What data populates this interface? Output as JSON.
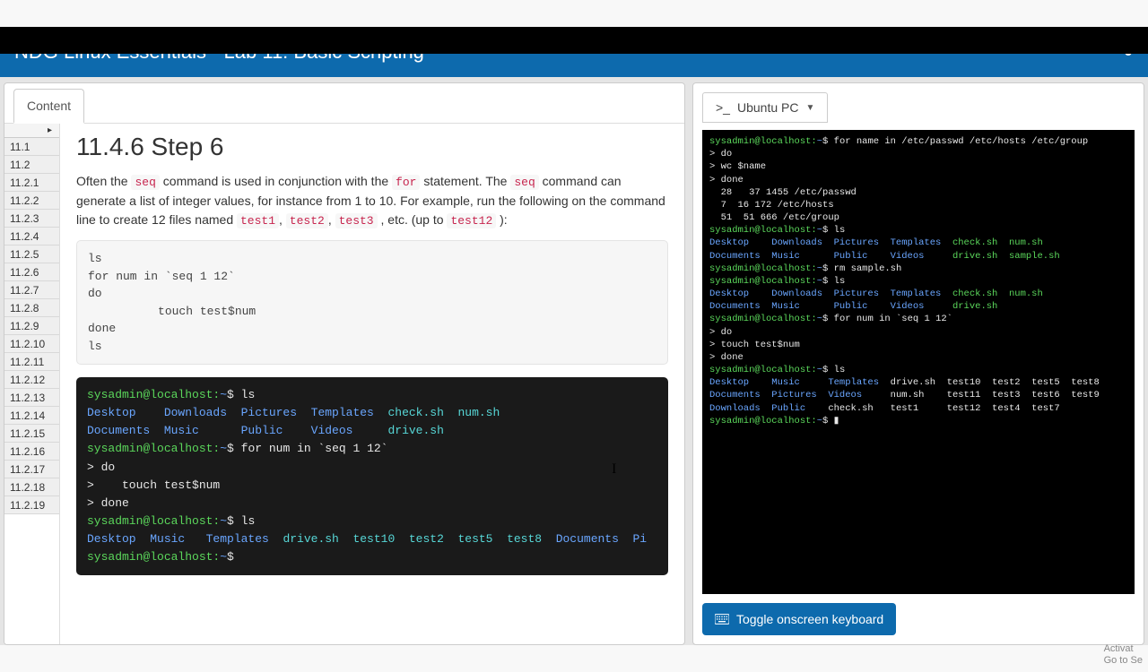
{
  "header": {
    "title": "NDG Linux Essentials - Lab 11: Basic Scripting"
  },
  "left": {
    "tab": "Content",
    "nav_expand": "▸",
    "nav": [
      "11.1",
      "11.2",
      "11.2.1",
      "11.2.2",
      "11.2.3",
      "11.2.4",
      "11.2.5",
      "11.2.6",
      "11.2.7",
      "11.2.8",
      "11.2.9",
      "11.2.10",
      "11.2.11",
      "11.2.12",
      "11.2.13",
      "11.2.14",
      "11.2.15",
      "11.2.16",
      "11.2.17",
      "11.2.18",
      "11.2.19"
    ],
    "article": {
      "heading": "11.4.6 Step 6",
      "p1a": "Often the ",
      "seq": "seq",
      "p1b": " command is used in conjunction with the ",
      "for": "for",
      "p1c": " statement. The ",
      "p1d": " command can generate a list of integer values, for instance from 1 to 10. For example, run the following on the command line to create 12 files named ",
      "t1": "test1",
      "t2": "test2",
      "t3": "test3",
      "etc": " , etc. (up to ",
      "t12": "test12",
      "close": " ):",
      "codebox": "ls\nfor num in `seq 1 12`\ndo\n          touch test$num\ndone\nls",
      "term": {
        "prompt": "sysadmin@localhost:",
        "tilde": "~",
        "dollar": "$",
        "cmd1": " ls",
        "row1": "Desktop    Downloads  Pictures  Templates  ",
        "row1b": "check.sh  num.sh",
        "row2": "Documents  Music      Public    Videos     ",
        "row2b": "drive.sh",
        "cmd2": " for num in `seq 1 12`",
        "l_do": "> do",
        "l_touch": ">    touch test$num",
        "l_done": "> done",
        "cmd3": " ls",
        "row3a": "Desktop  Music   Templates  ",
        "row3b": "drive.sh  test10  test2  test5  test8  ",
        "row3c": "Documents  Pi"
      }
    }
  },
  "right": {
    "vm_prompt": ">_",
    "vm_label": "Ubuntu PC",
    "screen": {
      "p": "sysadmin@localhost:",
      "t": "~",
      "d": "$",
      "l1": " for name in /etc/passwd /etc/hosts /etc/group",
      "l2": "> do",
      "l3": "> wc $name",
      "l4": "> done",
      "l5": "  28   37 1455 /etc/passwd",
      "l6": "  7  16 172 /etc/hosts",
      "l7": "  51  51 666 /etc/group",
      "l8": " ls",
      "r1": "Desktop    Downloads  Pictures  Templates  ",
      "r1b": "check.sh  num.sh",
      "r2": "Documents  Music      Public    Videos     ",
      "r2b": "drive.sh  sample.sh",
      "l9": " rm sample.sh",
      "l10": " ls",
      "r3": "Desktop    Downloads  Pictures  Templates  ",
      "r3b": "check.sh  num.sh",
      "r4": "Documents  Music      Public    Videos     ",
      "r4b": "drive.sh",
      "l11": " for num in `seq 1 12`",
      "l12": "> do",
      "l13": "> touch test$num",
      "l14": "> done",
      "l15": " ls",
      "g1": "Desktop    Music     Templates  ",
      "g1b": "drive.sh  test10  test2  test5  test8",
      "g2": "Documents  Pictures  Videos     ",
      "g2b": "num.sh    test11  test3  test6  test9",
      "g3": "Downloads  Public    ",
      "g3b": "check.sh   test1     test12  test4  test7",
      "cursor": "▮"
    },
    "button": "Toggle onscreen keyboard"
  },
  "watermark": {
    "l1": "Activat",
    "l2": "Go to Se"
  }
}
